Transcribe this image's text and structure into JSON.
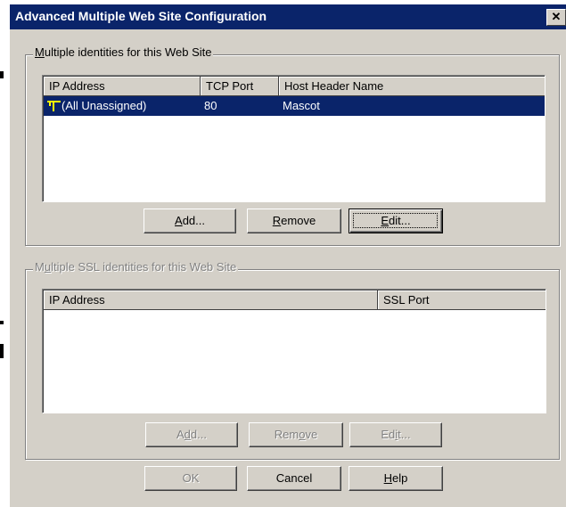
{
  "dialog": {
    "title": "Advanced Multiple Web Site Configuration",
    "close_glyph": "✕"
  },
  "identities": {
    "label_mnemonic": "M",
    "label_rest": "ultiple identities for this Web Site",
    "columns": [
      "IP Address",
      "TCP Port",
      "Host Header Name"
    ],
    "rows": [
      {
        "ip": "(All Unassigned)",
        "port": "80",
        "host": "Mascot",
        "icon": "network-icon"
      }
    ],
    "buttons": [
      {
        "mn": "A",
        "rest": "dd...",
        "enabled": true
      },
      {
        "mn": "R",
        "rest": "emove",
        "enabled": true
      },
      {
        "mn": "E",
        "rest": "dit...",
        "enabled": true,
        "focused": true
      }
    ]
  },
  "ssl": {
    "label_pre": "M",
    "label_mnemonic": "u",
    "label_rest": "ltiple SSL identities for this Web Site",
    "columns": [
      "IP Address",
      "SSL Port"
    ],
    "buttons": [
      {
        "pre": "A",
        "mn": "d",
        "rest": "d...",
        "enabled": false
      },
      {
        "pre": "Rem",
        "mn": "o",
        "rest": "ve",
        "enabled": false
      },
      {
        "pre": "Ed",
        "mn": "i",
        "rest": "t...",
        "enabled": false
      }
    ]
  },
  "footer": {
    "ok": "OK",
    "cancel": "Cancel",
    "help_mn": "H",
    "help_rest": "elp"
  },
  "colors": {
    "selection": "#0a246a",
    "face": "#d4d0c8"
  }
}
